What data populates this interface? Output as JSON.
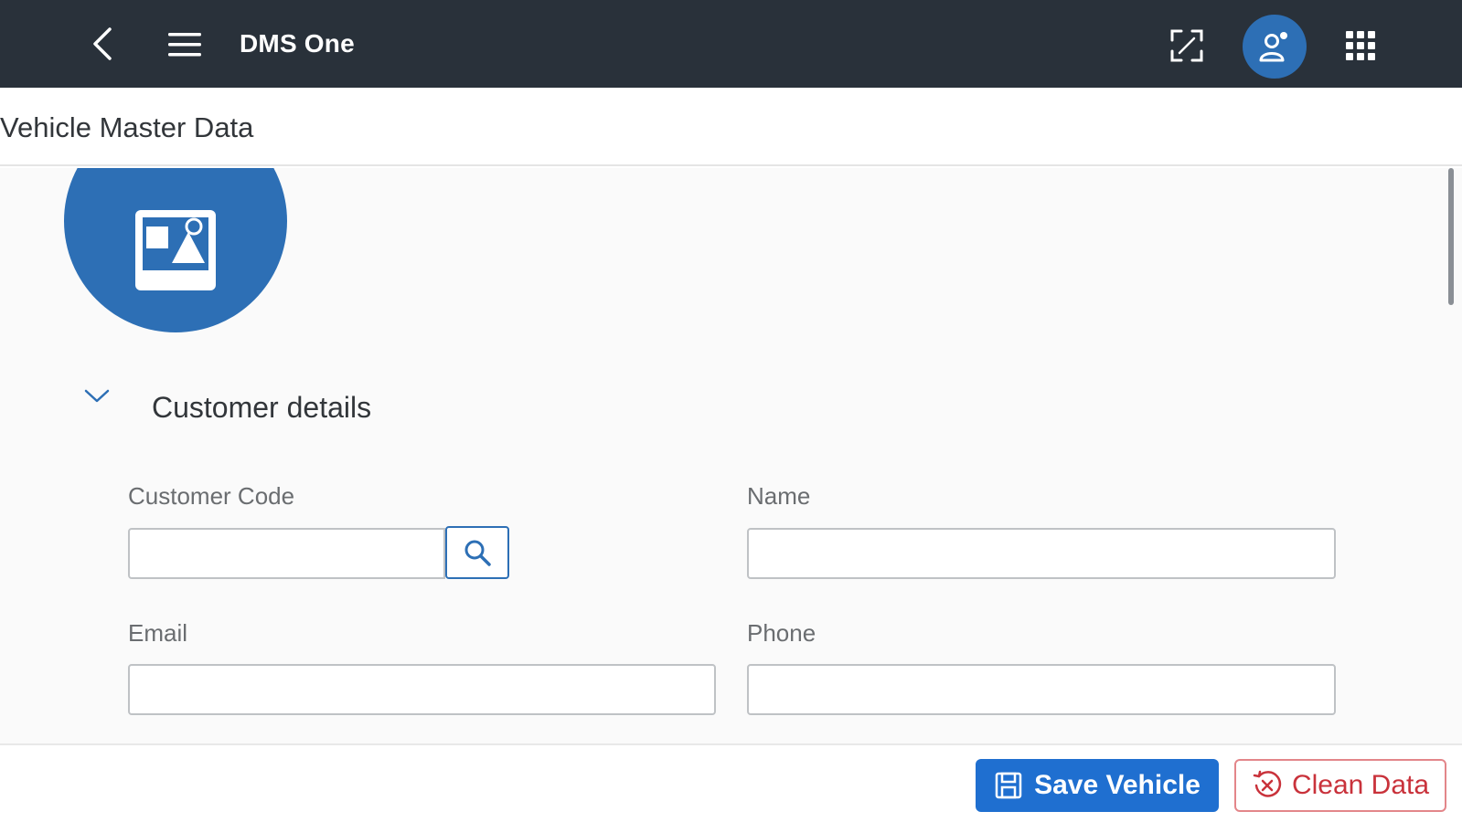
{
  "shell": {
    "title": "DMS One",
    "colors": {
      "bar": "#29313a",
      "accent": "#2d6fb5"
    },
    "icons": [
      "back-arrow-icon",
      "hamburger-menu-icon",
      "fullscreen-icon",
      "user-avatar-icon",
      "app-grid-icon"
    ]
  },
  "page": {
    "title": "Vehicle Master Data",
    "image_icon": "image-placeholder-icon"
  },
  "section": {
    "title": "Customer details",
    "expanded": true
  },
  "form": {
    "customer_code": {
      "label": "Customer Code",
      "value": ""
    },
    "name": {
      "label": "Name",
      "value": ""
    },
    "email": {
      "label": "Email",
      "value": ""
    },
    "phone": {
      "label": "Phone",
      "value": ""
    }
  },
  "footer": {
    "save_label": "Save Vehicle",
    "clean_label": "Clean Data",
    "colors": {
      "save": "#1f6fd0",
      "clean": "#c9323b"
    }
  }
}
